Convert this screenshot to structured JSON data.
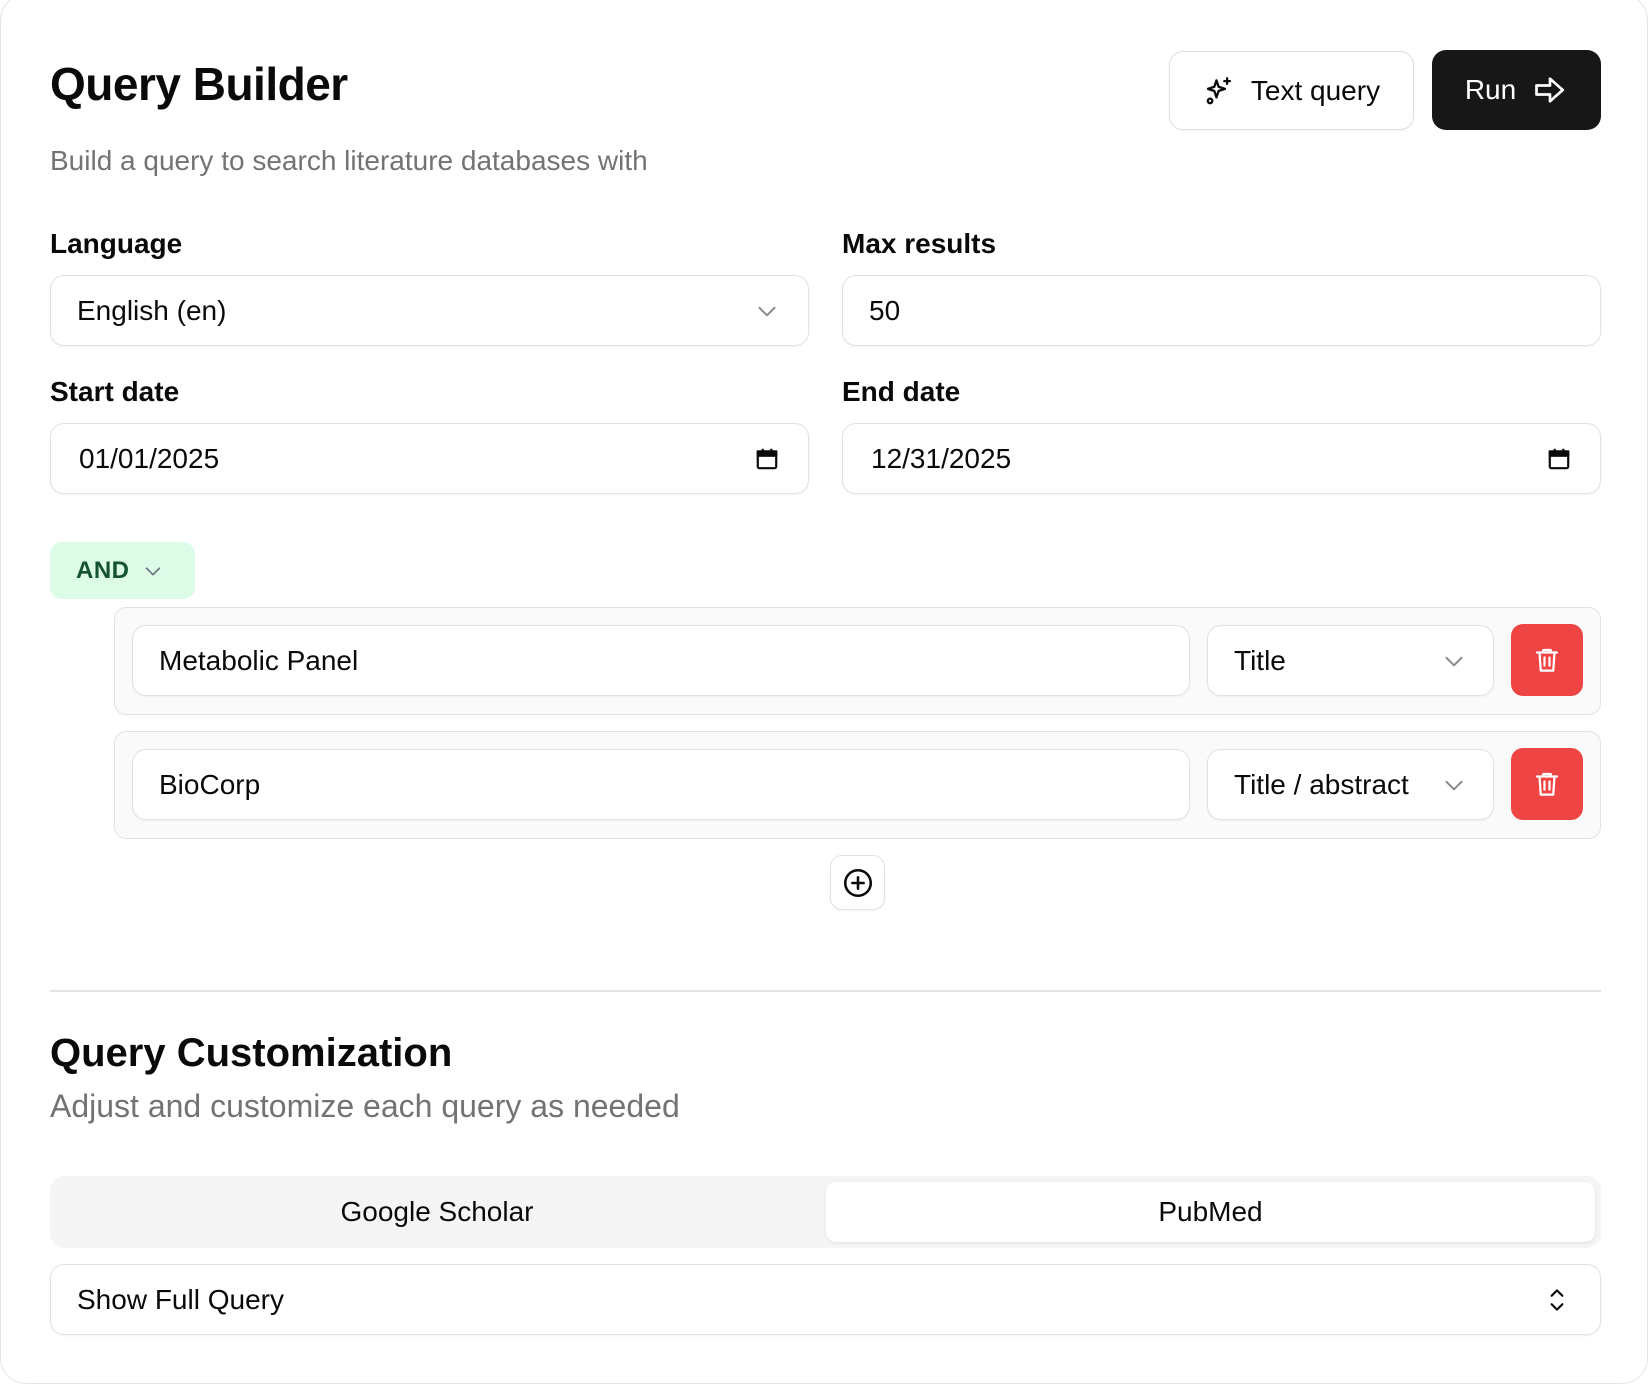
{
  "header": {
    "title": "Query Builder",
    "subtitle": "Build a query to search literature databases with",
    "text_query_label": "Text query",
    "run_label": "Run"
  },
  "fields": {
    "language": {
      "label": "Language",
      "value": "English (en)"
    },
    "max_results": {
      "label": "Max results",
      "value": "50"
    },
    "start_date": {
      "label": "Start date",
      "value": "01/01/2025"
    },
    "end_date": {
      "label": "End date",
      "value": "12/31/2025"
    }
  },
  "logic": {
    "operator": "AND"
  },
  "rules": [
    {
      "term": "Metabolic Panel",
      "field": "Title"
    },
    {
      "term": "BioCorp",
      "field": "Title / abstract"
    }
  ],
  "customization": {
    "title": "Query Customization",
    "subtitle": "Adjust and customize each query as needed",
    "tabs": [
      {
        "label": "Google Scholar",
        "active": false
      },
      {
        "label": "PubMed",
        "active": true
      }
    ],
    "show_full_query_label": "Show Full Query"
  },
  "colors": {
    "primary": "#171717",
    "danger": "#ef4444",
    "logic_bg": "#dcfce7",
    "muted_text": "#737373"
  },
  "icons": {
    "text_query": "sparkles-icon",
    "run": "arrow-right-icon",
    "select": "chevron-down-icon",
    "date": "calendar-icon",
    "delete": "trash-icon",
    "add": "plus-circle-icon",
    "expand": "chevrons-up-down-icon"
  }
}
